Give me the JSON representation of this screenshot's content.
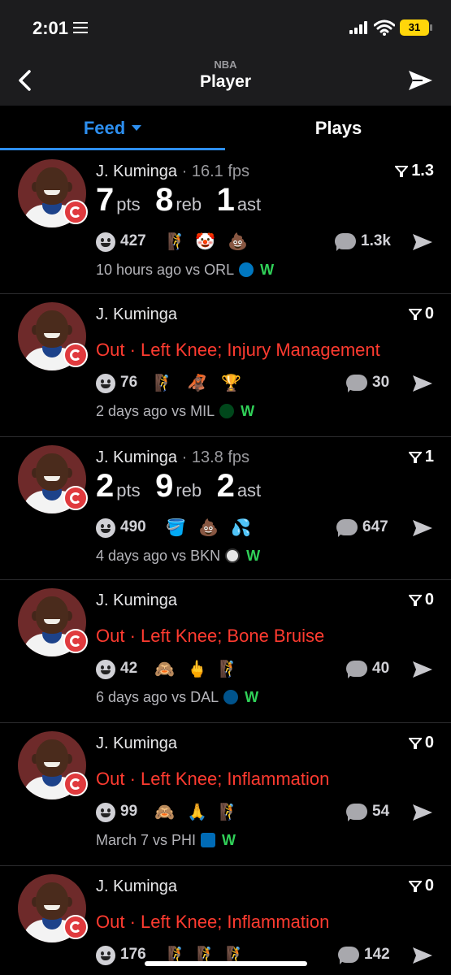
{
  "status_bar": {
    "time": "2:01",
    "battery": "31"
  },
  "nav": {
    "subtitle": "NBA",
    "title": "Player"
  },
  "tabs": {
    "feed": "Feed",
    "plays": "Plays"
  },
  "feed": [
    {
      "player": "J. Kuminga",
      "fps": " · 16.1 fps",
      "score": "1.3",
      "stats": [
        {
          "value": "7",
          "unit": "pts"
        },
        {
          "value": "8",
          "unit": "reb"
        },
        {
          "value": "1",
          "unit": "ast"
        }
      ],
      "reaction_count": "427",
      "emojis": [
        "🧗",
        "🤡",
        "💩"
      ],
      "comments": "1.3k",
      "time": "10 hours ago vs ORL",
      "opponent_color": "#0077c0",
      "result": "W"
    },
    {
      "player": "J. Kuminga",
      "score": "0",
      "status": "Out · Left Knee; Injury Management",
      "reaction_count": "76",
      "emojis": [
        "🧗",
        "🦧",
        "🏆"
      ],
      "comments": "30",
      "time": "2 days ago vs MIL",
      "opponent_color": "#00471b",
      "result": "W"
    },
    {
      "player": "J. Kuminga",
      "fps": " · 13.8 fps",
      "score": "1",
      "stats": [
        {
          "value": "2",
          "unit": "pts"
        },
        {
          "value": "9",
          "unit": "reb"
        },
        {
          "value": "2",
          "unit": "ast"
        }
      ],
      "reaction_count": "490",
      "emojis": [
        "🪣",
        "💩",
        "💦"
      ],
      "comments": "647",
      "time": "4 days ago vs BKN",
      "opponent_color": "#e6e6e6",
      "result": "W"
    },
    {
      "player": "J. Kuminga",
      "score": "0",
      "status": "Out · Left Knee; Bone Bruise",
      "reaction_count": "42",
      "emojis": [
        "🙈",
        "🖕",
        "🧗"
      ],
      "comments": "40",
      "time": "6 days ago vs DAL",
      "opponent_color": "#00538c",
      "result": "W"
    },
    {
      "player": "J. Kuminga",
      "score": "0",
      "status": "Out · Left Knee; Inflammation",
      "reaction_count": "99",
      "emojis": [
        "🙈",
        "🙏",
        "🧗"
      ],
      "comments": "54",
      "time": "March 7 vs PHI",
      "opponent_color": "#006bb6",
      "result": "W"
    },
    {
      "player": "J. Kuminga",
      "score": "0",
      "status": "Out · Left Knee; Inflammation",
      "reaction_count": "176",
      "emojis": [
        "🧗",
        "🧗",
        "🧗"
      ],
      "comments": "142"
    }
  ]
}
